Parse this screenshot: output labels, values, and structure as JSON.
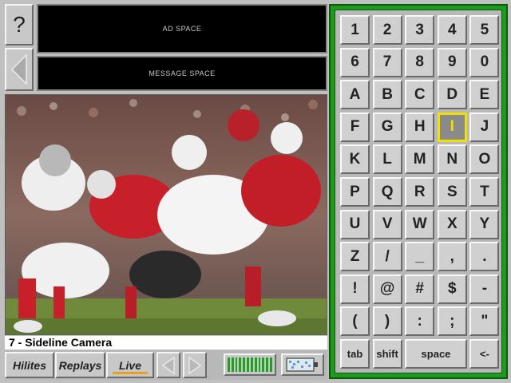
{
  "help_label": "?",
  "ad_space_label": "AD SPACE",
  "message_space_label": "MESSAGE SPACE",
  "camera_caption": "7 - Sideline Camera",
  "tabs": {
    "hilites": "Hilites",
    "replays": "Replays",
    "live": "Live"
  },
  "active_tab": "Live",
  "keyboard": {
    "selected_key": "I",
    "rows": [
      [
        "1",
        "2",
        "3",
        "4",
        "5"
      ],
      [
        "6",
        "7",
        "8",
        "9",
        "0"
      ],
      [
        "A",
        "B",
        "C",
        "D",
        "E"
      ],
      [
        "F",
        "G",
        "H",
        "I",
        "J"
      ],
      [
        "K",
        "L",
        "M",
        "N",
        "O"
      ],
      [
        "P",
        "Q",
        "R",
        "S",
        "T"
      ],
      [
        "U",
        "V",
        "W",
        "X",
        "Y"
      ],
      [
        "Z",
        "/",
        "_",
        ",",
        "."
      ],
      [
        "!",
        "@",
        "#",
        "$",
        "-"
      ],
      [
        "(",
        ")",
        ":",
        ";",
        "\""
      ]
    ],
    "bottom_row": {
      "tab": "tab",
      "shift": "shift",
      "space": "space",
      "backspace": "<-"
    }
  },
  "colors": {
    "keyboard_frame": "#1e9a1e",
    "selected_key_border": "#f0e000",
    "live_underline": "#e8a020",
    "signal": "#1fa01f"
  },
  "icons": [
    "back-arrow-icon",
    "prev-arrow-icon",
    "next-arrow-icon",
    "signal-meter-icon",
    "battery-icon"
  ]
}
